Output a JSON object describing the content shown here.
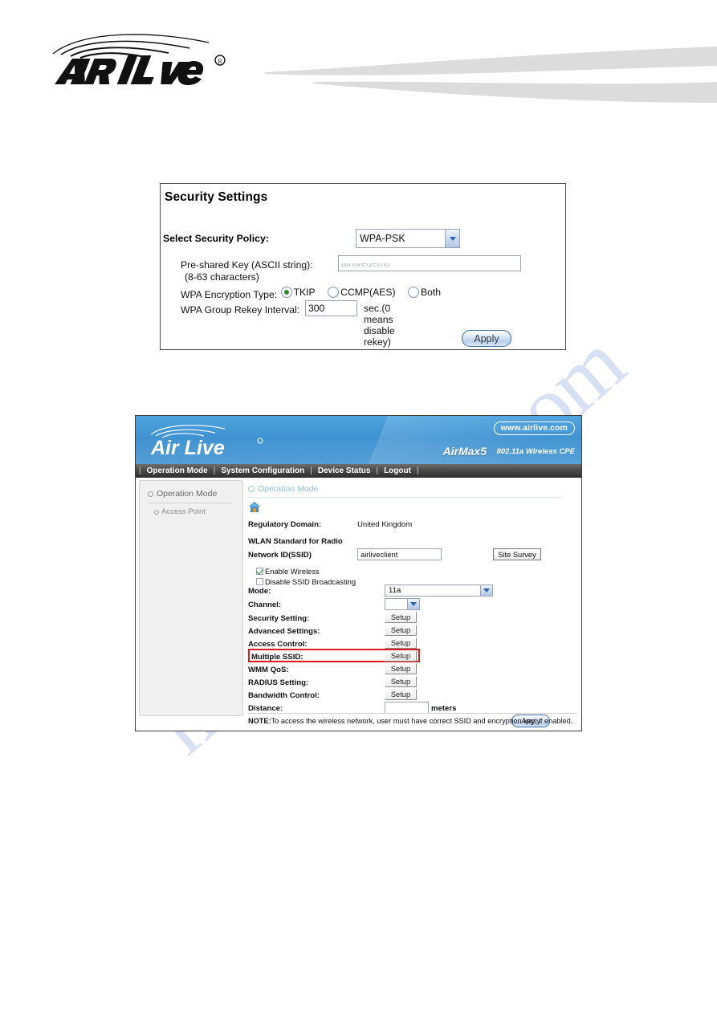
{
  "page": {
    "watermark_text": "manualshive.com",
    "brand": "AirLive"
  },
  "security_settings": {
    "title": "Security Settings",
    "policy_label": "Select Security Policy:",
    "policy_value": "WPA-PSK",
    "psk_label": "Pre-shared Key (ASCII string):",
    "psk_value": "airlivedemo",
    "psk_hint": "(8-63 characters)",
    "encryption_label": "WPA Encryption Type:",
    "encryption_options": [
      {
        "label": "TKIP",
        "selected": true
      },
      {
        "label": "CCMP(AES)",
        "selected": false
      },
      {
        "label": "Both",
        "selected": false
      }
    ],
    "rekey_label": "WPA Group Rekey Interval:",
    "rekey_value": "300",
    "rekey_suffix": "sec.(0 means disable rekey)",
    "apply_label": "Apply"
  },
  "router_ui": {
    "banner": {
      "url_badge": "www.airlive.com",
      "model": "AirMax5",
      "subtitle": "802.11a Wireless CPE"
    },
    "nav_items": [
      "Operation Mode",
      "System Configuration",
      "Device Status",
      "Logout"
    ],
    "sidebar": {
      "heading": "Operation Mode",
      "items": [
        "Access Point"
      ]
    },
    "breadcrumb": "Operation Mode",
    "fields": {
      "regulatory_domain_label": "Regulatory Domain:",
      "regulatory_domain_value": "United Kingdom",
      "wlan_standard_label": "WLAN Standard for Radio",
      "ssid_label": "Network ID(SSID)",
      "ssid_value": "airliveclient",
      "site_survey_label": "Site Survey",
      "enable_wireless_label": "Enable Wireless",
      "enable_wireless_checked": true,
      "disable_ssid_broadcast_label": "Disable SSID Broadcasting",
      "disable_ssid_broadcast_checked": false,
      "mode_label": "Mode:",
      "mode_value": "11a",
      "channel_label": "Channel:",
      "channel_value": "",
      "distance_label": "Distance:",
      "distance_value": "",
      "distance_unit": "meters"
    },
    "setup_rows": [
      {
        "label": "Security Setting:",
        "button": "Setup",
        "highlighted": false
      },
      {
        "label": "Advanced Settings:",
        "button": "Setup",
        "highlighted": false
      },
      {
        "label": "Access Control:",
        "button": "Setup",
        "highlighted": false
      },
      {
        "label": "Multiple SSID:",
        "button": "Setup",
        "highlighted": true
      },
      {
        "label": "WMM QoS:",
        "button": "Setup",
        "highlighted": false
      },
      {
        "label": "RADIUS Setting:",
        "button": "Setup",
        "highlighted": false
      },
      {
        "label": "Bandwidth Control:",
        "button": "Setup",
        "highlighted": false
      }
    ],
    "apply_label": "Apply",
    "note_prefix": "NOTE:",
    "note_text": "To access the wireless network, user must have correct SSID and encryption key, if enabled.",
    "colors": {
      "banner_blue": "#3f93d2",
      "nav_dark": "#4a4a4a",
      "highlight_red": "#e01b1b",
      "accent_blue": "#2b5fa8"
    }
  }
}
